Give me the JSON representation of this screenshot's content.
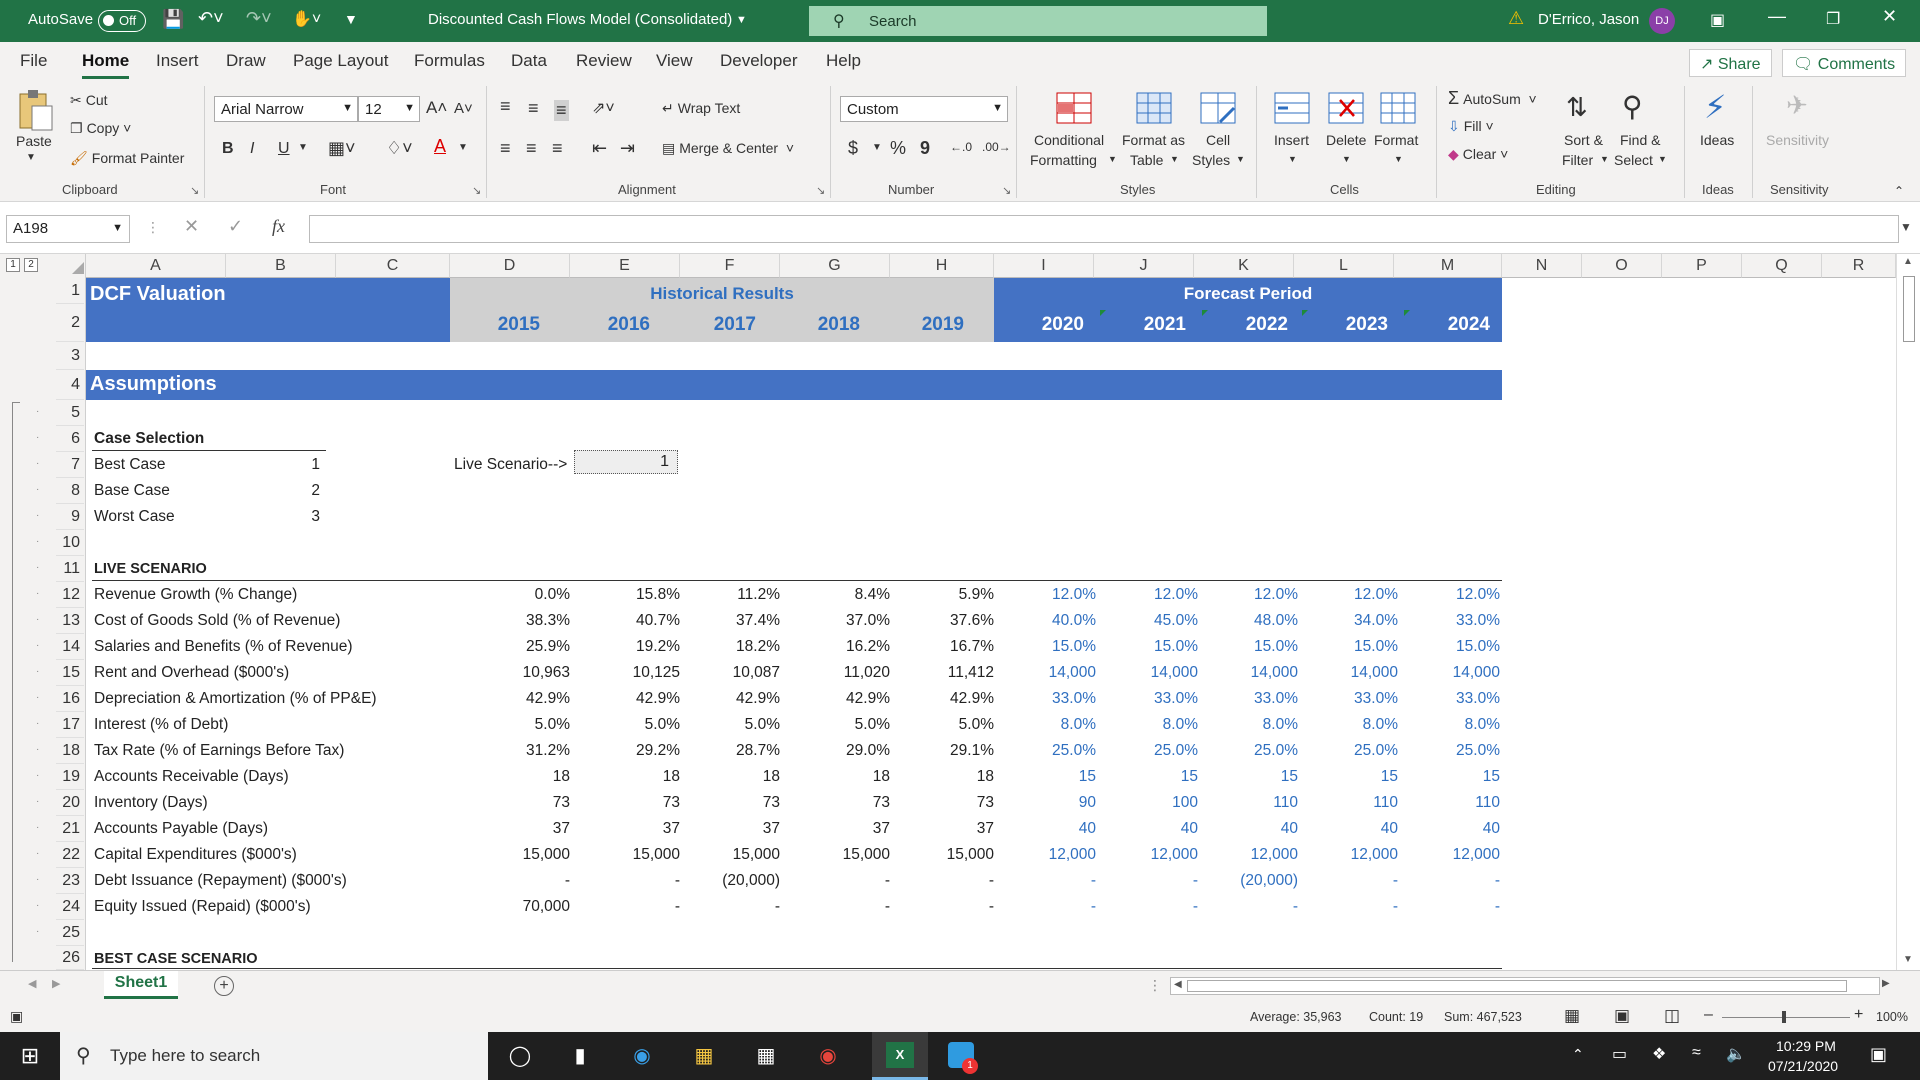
{
  "titlebar": {
    "autosave_label": "AutoSave",
    "autosave_state": "Off",
    "doc_title": "Discounted Cash Flows Model (Consolidated)",
    "search_placeholder": "Search",
    "user_name": "D'Errico, Jason",
    "user_initials": "DJ"
  },
  "tabs": [
    "File",
    "Home",
    "Insert",
    "Draw",
    "Page Layout",
    "Formulas",
    "Data",
    "Review",
    "View",
    "Developer",
    "Help"
  ],
  "share_label": "Share",
  "comments_label": "Comments",
  "ribbon": {
    "paste": "Paste",
    "cut": "Cut",
    "copy": "Copy",
    "format_painter": "Format Painter",
    "clipboard": "Clipboard",
    "font_name": "Arial Narrow",
    "font_size": "12",
    "bold": "B",
    "italic": "I",
    "underline": "U",
    "font": "Font",
    "wrap_text": "Wrap Text",
    "merge_center": "Merge & Center",
    "alignment": "Alignment",
    "number_format": "Custom",
    "currency": "$",
    "percent": "%",
    "comma": "9",
    "number": "Number",
    "conditional_formatting_1": "Conditional",
    "conditional_formatting_2": "Formatting",
    "format_table_1": "Format as",
    "format_table_2": "Table",
    "cell_styles_1": "Cell",
    "cell_styles_2": "Styles",
    "styles": "Styles",
    "insert": "Insert",
    "delete": "Delete",
    "format": "Format",
    "cells": "Cells",
    "autosum": "AutoSum",
    "fill": "Fill",
    "clear": "Clear",
    "sort_filter_1": "Sort &",
    "sort_filter_2": "Filter",
    "find_select_1": "Find &",
    "find_select_2": "Select",
    "editing": "Editing",
    "ideas": "Ideas",
    "ideas_group": "Ideas",
    "sensitivity": "Sensitivity",
    "sensitivity_group": "Sensitivity"
  },
  "formula_bar": {
    "name_box": "A198",
    "fx": "fx",
    "formula": ""
  },
  "columns": [
    "A",
    "B",
    "C",
    "D",
    "E",
    "F",
    "G",
    "H",
    "I",
    "J",
    "K",
    "L",
    "M",
    "N",
    "O",
    "P",
    "Q",
    "R"
  ],
  "rows": [
    "1",
    "2",
    "3",
    "4",
    "5",
    "6",
    "7",
    "8",
    "9",
    "10",
    "11",
    "12",
    "13",
    "14",
    "15",
    "16",
    "17",
    "18",
    "19",
    "20",
    "21",
    "22",
    "23",
    "24",
    "25",
    "26"
  ],
  "sheet": {
    "dcf_title": "DCF Valuation",
    "historical_title": "Historical Results",
    "forecast_title": "Forecast Period",
    "hist_years": [
      "2015",
      "2016",
      "2017",
      "2018",
      "2019"
    ],
    "fore_years": [
      "2020",
      "2021",
      "2022",
      "2023",
      "2024"
    ],
    "assumptions": "Assumptions",
    "case_selection": "Case Selection",
    "cases": [
      {
        "name": "Best Case",
        "value": "1"
      },
      {
        "name": "Base Case",
        "value": "2"
      },
      {
        "name": "Worst Case",
        "value": "3"
      }
    ],
    "live_scenario_label": "Live Scenario-->",
    "live_scenario_value": "1",
    "live_scenario_heading": "LIVE SCENARIO",
    "best_case_heading": "BEST CASE SCENARIO",
    "metrics": [
      {
        "label": "Revenue Growth (% Change)",
        "hist": [
          "0.0%",
          "15.8%",
          "11.2%",
          "8.4%",
          "5.9%"
        ],
        "fore": [
          "12.0%",
          "12.0%",
          "12.0%",
          "12.0%",
          "12.0%"
        ]
      },
      {
        "label": "Cost of Goods Sold (% of Revenue)",
        "hist": [
          "38.3%",
          "40.7%",
          "37.4%",
          "37.0%",
          "37.6%"
        ],
        "fore": [
          "40.0%",
          "45.0%",
          "48.0%",
          "34.0%",
          "33.0%"
        ]
      },
      {
        "label": "Salaries and Benefits (% of Revenue)",
        "hist": [
          "25.9%",
          "19.2%",
          "18.2%",
          "16.2%",
          "16.7%"
        ],
        "fore": [
          "15.0%",
          "15.0%",
          "15.0%",
          "15.0%",
          "15.0%"
        ]
      },
      {
        "label": "Rent and Overhead ($000's)",
        "hist": [
          "10,963",
          "10,125",
          "10,087",
          "11,020",
          "11,412"
        ],
        "fore": [
          "14,000",
          "14,000",
          "14,000",
          "14,000",
          "14,000"
        ]
      },
      {
        "label": "Depreciation & Amortization (% of PP&E)",
        "hist": [
          "42.9%",
          "42.9%",
          "42.9%",
          "42.9%",
          "42.9%"
        ],
        "fore": [
          "33.0%",
          "33.0%",
          "33.0%",
          "33.0%",
          "33.0%"
        ]
      },
      {
        "label": "Interest (% of Debt)",
        "hist": [
          "5.0%",
          "5.0%",
          "5.0%",
          "5.0%",
          "5.0%"
        ],
        "fore": [
          "8.0%",
          "8.0%",
          "8.0%",
          "8.0%",
          "8.0%"
        ]
      },
      {
        "label": "Tax Rate (% of Earnings Before Tax)",
        "hist": [
          "31.2%",
          "29.2%",
          "28.7%",
          "29.0%",
          "29.1%"
        ],
        "fore": [
          "25.0%",
          "25.0%",
          "25.0%",
          "25.0%",
          "25.0%"
        ]
      },
      {
        "label": "Accounts Receivable (Days)",
        "hist": [
          "18",
          "18",
          "18",
          "18",
          "18"
        ],
        "fore": [
          "15",
          "15",
          "15",
          "15",
          "15"
        ]
      },
      {
        "label": "Inventory (Days)",
        "hist": [
          "73",
          "73",
          "73",
          "73",
          "73"
        ],
        "fore": [
          "90",
          "100",
          "110",
          "110",
          "110"
        ]
      },
      {
        "label": "Accounts Payable (Days)",
        "hist": [
          "37",
          "37",
          "37",
          "37",
          "37"
        ],
        "fore": [
          "40",
          "40",
          "40",
          "40",
          "40"
        ]
      },
      {
        "label": "Capital Expenditures ($000's)",
        "hist": [
          "15,000",
          "15,000",
          "15,000",
          "15,000",
          "15,000"
        ],
        "fore": [
          "12,000",
          "12,000",
          "12,000",
          "12,000",
          "12,000"
        ]
      },
      {
        "label": "Debt Issuance (Repayment) ($000's)",
        "hist": [
          "-",
          "-",
          "(20,000)",
          "-",
          "-"
        ],
        "fore": [
          "-",
          "-",
          "(20,000)",
          "-",
          "-"
        ]
      },
      {
        "label": "Equity Issued (Repaid) ($000's)",
        "hist": [
          "70,000",
          "-",
          "-",
          "-",
          "-"
        ],
        "fore": [
          "-",
          "-",
          "-",
          "-",
          "-"
        ]
      }
    ]
  },
  "sheet_tab": "Sheet1",
  "status": {
    "average": "Average: 35,963",
    "count": "Count: 19",
    "sum": "Sum: 467,523",
    "zoom": "100%"
  },
  "taskbar": {
    "search_placeholder": "Type here to search",
    "time": "10:29 PM",
    "date": "07/21/2020",
    "notification_count": "1"
  },
  "colors": {
    "excel_green": "#217346",
    "header_blue": "#4472c4",
    "forecast_text_blue": "#2f6fc0",
    "historical_grey": "#d0d0d0"
  }
}
